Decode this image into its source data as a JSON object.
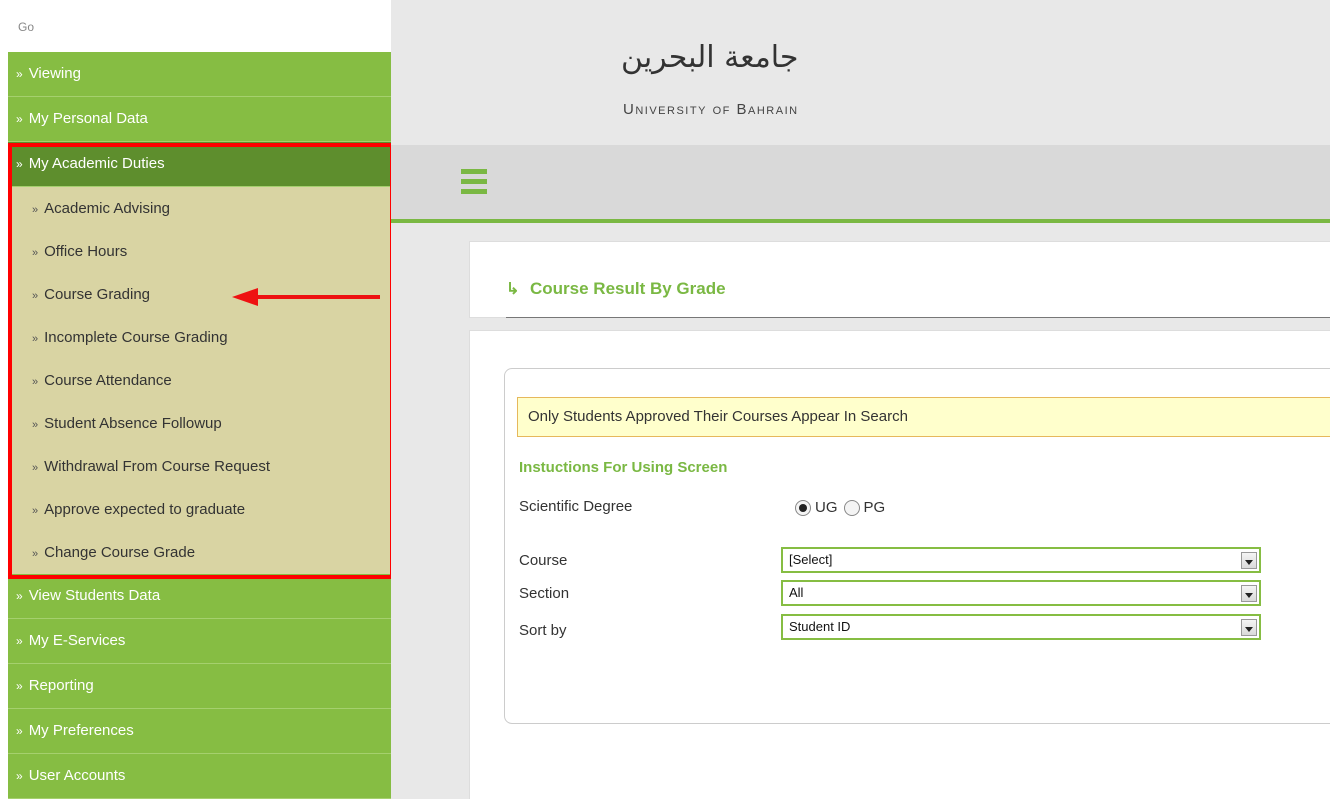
{
  "sidebar": {
    "go_label": "Go",
    "items": [
      {
        "label": "Viewing"
      },
      {
        "label": "My Personal Data"
      },
      {
        "label": "My Academic Duties"
      }
    ],
    "active_submenu": [
      {
        "label": "Academic Advising"
      },
      {
        "label": "Office Hours"
      },
      {
        "label": "Course Grading"
      },
      {
        "label": "Incomplete Course Grading"
      },
      {
        "label": "Course Attendance"
      },
      {
        "label": "Student Absence Followup"
      },
      {
        "label": "Withdrawal From Course Request"
      },
      {
        "label": "Approve expected to graduate"
      },
      {
        "label": "Change Course Grade"
      }
    ],
    "items_after": [
      {
        "label": "View Students Data"
      },
      {
        "label": "My E-Services"
      },
      {
        "label": "Reporting"
      },
      {
        "label": "My Preferences"
      },
      {
        "label": "User Accounts"
      }
    ],
    "bullet": "»"
  },
  "header": {
    "logo_ar": "جامعة البحرين",
    "logo_en": "University of Bahrain"
  },
  "page": {
    "title_icon": "↳",
    "title": "Course Result By Grade",
    "notice": "Only Students Approved Their Courses Appear In Search",
    "instructions": "Instuctions For Using Screen",
    "degree_label": "Scientific Degree",
    "degree_options": [
      "UG",
      "PG"
    ],
    "degree_selected": "UG",
    "course_label": "Course",
    "course_value": "[Select]",
    "section_label": "Section",
    "section_value": "All",
    "sort_label": "Sort by",
    "sort_value": "Student ID"
  },
  "colors": {
    "menu_green": "#86bd43",
    "menu_active": "#5e8e2d",
    "submenu_bg": "#d9d4a3",
    "accent": "#7ab843",
    "highlight": "#ff0000"
  }
}
